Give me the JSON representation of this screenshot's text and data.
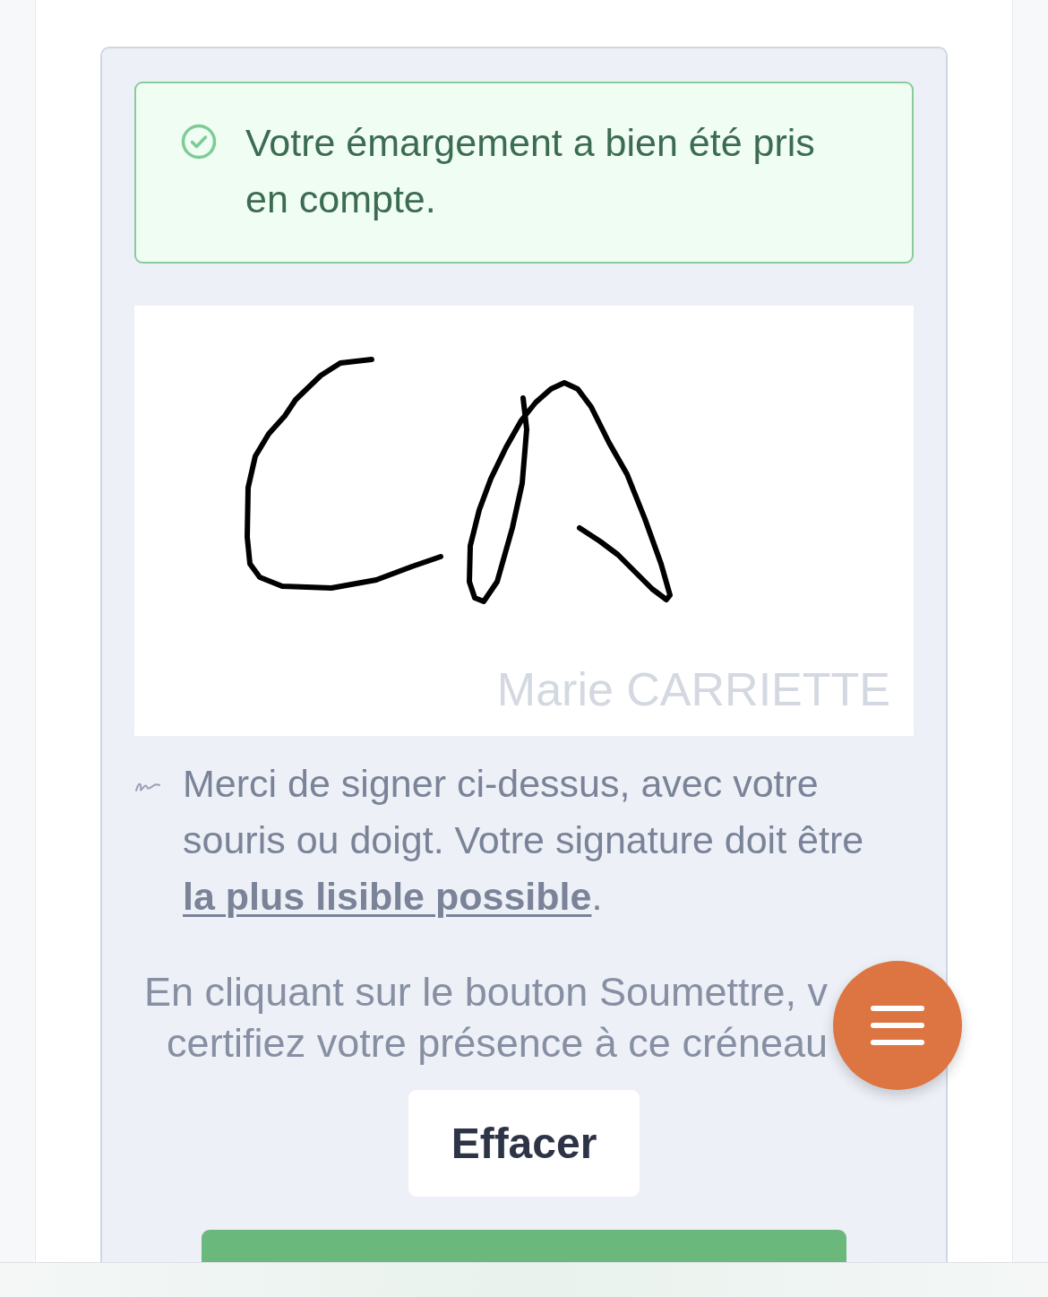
{
  "alert": {
    "kind": "success",
    "text": "Votre émargement a bien été pris en compte."
  },
  "signature_pad": {
    "signed": true,
    "signer_name": "Marie CARRIETTE"
  },
  "hint": {
    "text": "Merci de signer ci-dessus, avec votre souris ou doigt. Votre signature doit être **la plus lisible possible**."
  },
  "consent_lines": [
    "En cliquant sur le bouton Soumettre, v",
    "certifiez votre présence à ce créneau"
  ],
  "buttons": [
    {
      "kind": "secondary",
      "label": "Effacer"
    },
    {
      "kind": "primary"
    }
  ]
}
